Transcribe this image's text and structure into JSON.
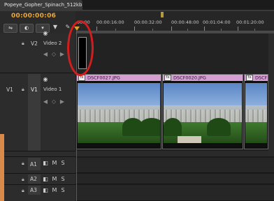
{
  "sequence": {
    "tab_title": "Popeye_Gopher_Spinach_512kb",
    "timecode": "00:00:00:06"
  },
  "ruler": {
    "labels": [
      "00:00",
      "00:00:16:00",
      "00:00:32:00",
      "00:00:48:00",
      "00:01:04:00",
      "00:01:20:00"
    ]
  },
  "tracks": {
    "v2": {
      "side_label": "V2",
      "name": "Video 2"
    },
    "v1": {
      "side_label": "V1",
      "target_label": "V1",
      "name": "Video 1"
    },
    "a1": {
      "label": "A1",
      "mute": "M",
      "solo": "S"
    },
    "a2": {
      "label": "A2",
      "mute": "M",
      "solo": "S"
    },
    "a3": {
      "label": "A3",
      "mute": "M",
      "solo": "S"
    }
  },
  "clips": [
    {
      "name": "DSCF0027.JPG",
      "fx": "fx"
    },
    {
      "name": "DSCF0020.JPG",
      "fx": "fx"
    },
    {
      "name": "DSCF",
      "fx": "fx"
    }
  ],
  "colors": {
    "timecode": "#f0a830",
    "clip_header": "#d59fd4",
    "annotation_circle": "#d41e1e",
    "playhead": "#c03030"
  }
}
